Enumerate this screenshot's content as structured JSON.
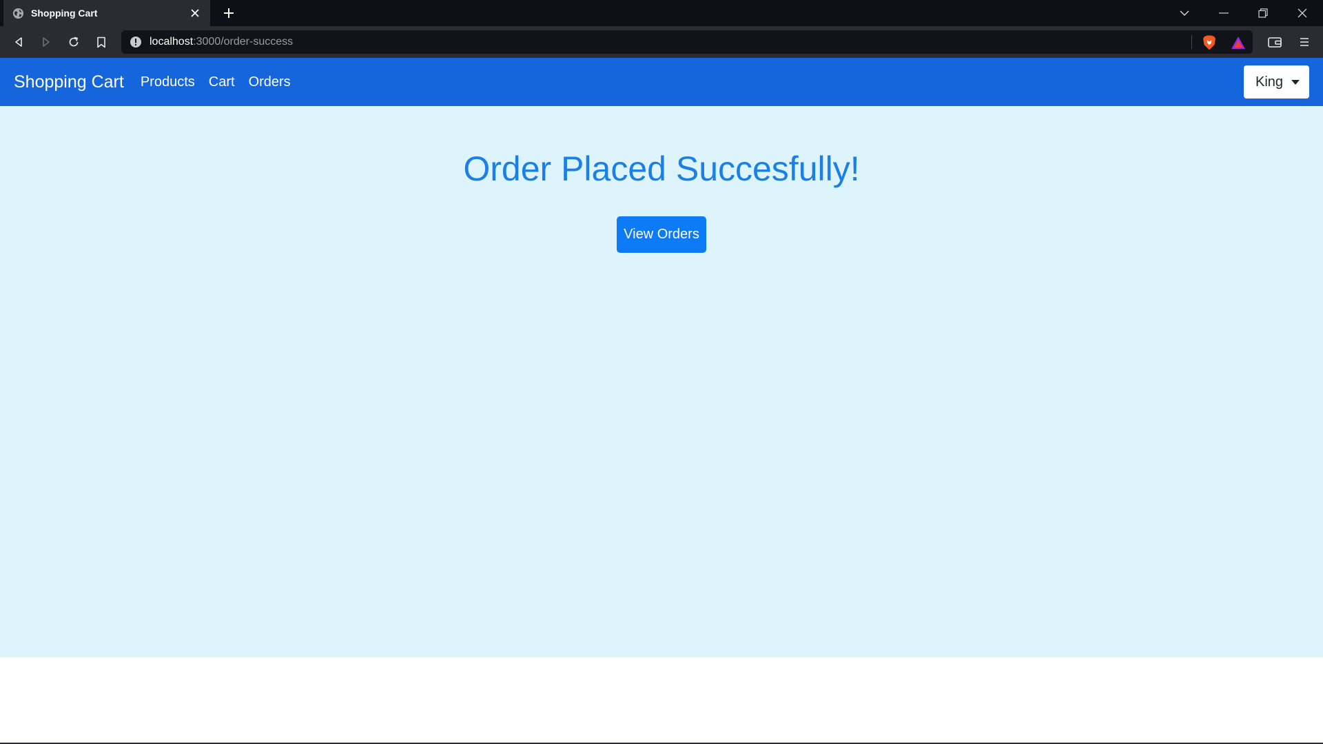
{
  "browser": {
    "tab": {
      "title": "Shopping Cart",
      "favicon": "globe-icon"
    },
    "url": {
      "host": "localhost",
      "rest": ":3000/order-success"
    },
    "extensions": [
      "brave-shield-icon",
      "brave-rewards-icon",
      "wallet-icon"
    ]
  },
  "navbar": {
    "brand": "Shopping Cart",
    "links": [
      "Products",
      "Cart",
      "Orders"
    ],
    "user": "King"
  },
  "main": {
    "title": "Order Placed Succesfully!",
    "button": "View Orders"
  },
  "colors": {
    "navbar": "#1565dd",
    "content_bg": "#def4fc",
    "title": "#1a7fe6",
    "button": "#0d7bf5"
  }
}
